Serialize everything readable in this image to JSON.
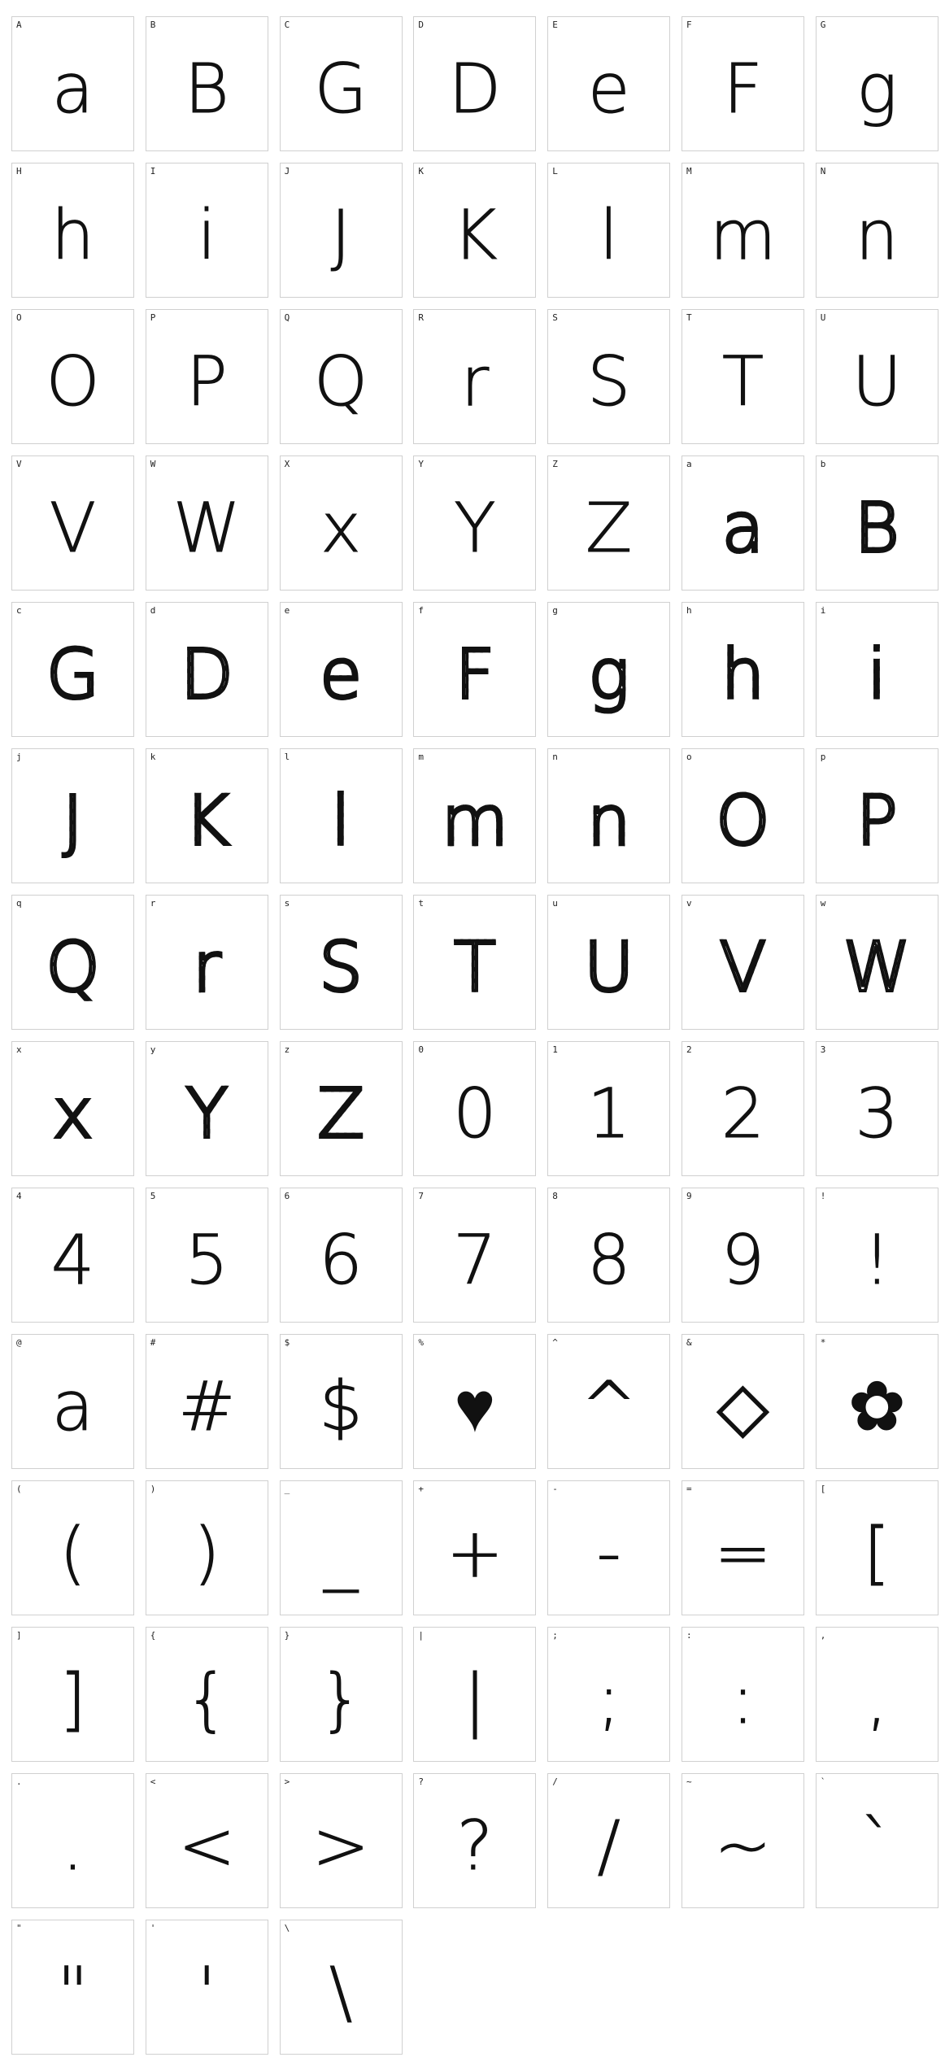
{
  "colors": {
    "background": "#ffffff",
    "cell_border": "#d0d0d0",
    "ink": "#111111"
  },
  "glyphs": [
    {
      "key": "A",
      "char": "a",
      "style": "outline"
    },
    {
      "key": "B",
      "char": "B",
      "style": "outline"
    },
    {
      "key": "C",
      "char": "G",
      "style": "outline"
    },
    {
      "key": "D",
      "char": "D",
      "style": "outline"
    },
    {
      "key": "E",
      "char": "e",
      "style": "outline"
    },
    {
      "key": "F",
      "char": "F",
      "style": "outline"
    },
    {
      "key": "G",
      "char": "g",
      "style": "outline"
    },
    {
      "key": "H",
      "char": "h",
      "style": "outline"
    },
    {
      "key": "I",
      "char": "i",
      "style": "outline"
    },
    {
      "key": "J",
      "char": "J",
      "style": "outline"
    },
    {
      "key": "K",
      "char": "K",
      "style": "outline"
    },
    {
      "key": "L",
      "char": "l",
      "style": "outline"
    },
    {
      "key": "M",
      "char": "m",
      "style": "outline"
    },
    {
      "key": "N",
      "char": "n",
      "style": "outline"
    },
    {
      "key": "O",
      "char": "O",
      "style": "outline"
    },
    {
      "key": "P",
      "char": "P",
      "style": "outline"
    },
    {
      "key": "Q",
      "char": "Q",
      "style": "outline"
    },
    {
      "key": "R",
      "char": "r",
      "style": "outline"
    },
    {
      "key": "S",
      "char": "S",
      "style": "outline"
    },
    {
      "key": "T",
      "char": "T",
      "style": "outline"
    },
    {
      "key": "U",
      "char": "U",
      "style": "outline"
    },
    {
      "key": "V",
      "char": "V",
      "style": "outline"
    },
    {
      "key": "W",
      "char": "W",
      "style": "outline"
    },
    {
      "key": "X",
      "char": "x",
      "style": "outline"
    },
    {
      "key": "Y",
      "char": "Y",
      "style": "outline"
    },
    {
      "key": "Z",
      "char": "Z",
      "style": "outline"
    },
    {
      "key": "a",
      "char": "a",
      "style": "hatched"
    },
    {
      "key": "b",
      "char": "B",
      "style": "hatched"
    },
    {
      "key": "c",
      "char": "G",
      "style": "hatched"
    },
    {
      "key": "d",
      "char": "D",
      "style": "hatched"
    },
    {
      "key": "e",
      "char": "e",
      "style": "hatched"
    },
    {
      "key": "f",
      "char": "F",
      "style": "hatched"
    },
    {
      "key": "g",
      "char": "g",
      "style": "hatched"
    },
    {
      "key": "h",
      "char": "h",
      "style": "hatched"
    },
    {
      "key": "i",
      "char": "i",
      "style": "hatched"
    },
    {
      "key": "j",
      "char": "J",
      "style": "hatched"
    },
    {
      "key": "k",
      "char": "K",
      "style": "hatched"
    },
    {
      "key": "l",
      "char": "l",
      "style": "hatched"
    },
    {
      "key": "m",
      "char": "m",
      "style": "hatched"
    },
    {
      "key": "n",
      "char": "n",
      "style": "hatched"
    },
    {
      "key": "o",
      "char": "O",
      "style": "hatched"
    },
    {
      "key": "p",
      "char": "P",
      "style": "hatched"
    },
    {
      "key": "q",
      "char": "Q",
      "style": "hatched"
    },
    {
      "key": "r",
      "char": "r",
      "style": "hatched"
    },
    {
      "key": "s",
      "char": "S",
      "style": "hatched"
    },
    {
      "key": "t",
      "char": "T",
      "style": "hatched"
    },
    {
      "key": "u",
      "char": "U",
      "style": "hatched"
    },
    {
      "key": "v",
      "char": "V",
      "style": "hatched"
    },
    {
      "key": "w",
      "char": "W",
      "style": "hatched"
    },
    {
      "key": "x",
      "char": "x",
      "style": "hatched"
    },
    {
      "key": "y",
      "char": "Y",
      "style": "hatched"
    },
    {
      "key": "z",
      "char": "Z",
      "style": "hatched"
    },
    {
      "key": "0",
      "char": "0",
      "style": "outline"
    },
    {
      "key": "1",
      "char": "1",
      "style": "outline"
    },
    {
      "key": "2",
      "char": "2",
      "style": "outline"
    },
    {
      "key": "3",
      "char": "3",
      "style": "outline"
    },
    {
      "key": "4",
      "char": "4",
      "style": "outline"
    },
    {
      "key": "5",
      "char": "5",
      "style": "outline"
    },
    {
      "key": "6",
      "char": "6",
      "style": "outline"
    },
    {
      "key": "7",
      "char": "7",
      "style": "outline"
    },
    {
      "key": "8",
      "char": "8",
      "style": "outline"
    },
    {
      "key": "9",
      "char": "9",
      "style": "outline"
    },
    {
      "key": "!",
      "char": "!",
      "style": "outline"
    },
    {
      "key": "@",
      "char": "a",
      "style": "outline"
    },
    {
      "key": "#",
      "char": "#",
      "style": "outline"
    },
    {
      "key": "$",
      "char": "$",
      "style": "outline"
    },
    {
      "key": "%",
      "char": "♥",
      "style": "outline"
    },
    {
      "key": "^",
      "char": "^",
      "style": "outline"
    },
    {
      "key": "&",
      "char": "◇",
      "style": "outline"
    },
    {
      "key": "*",
      "char": "✿",
      "style": "outline"
    },
    {
      "key": "(",
      "char": "(",
      "style": "outline"
    },
    {
      "key": ")",
      "char": ")",
      "style": "outline"
    },
    {
      "key": "_",
      "char": "_",
      "style": "outline"
    },
    {
      "key": "+",
      "char": "+",
      "style": "outline"
    },
    {
      "key": "-",
      "char": "-",
      "style": "outline"
    },
    {
      "key": "=",
      "char": "=",
      "style": "outline"
    },
    {
      "key": "[",
      "char": "[",
      "style": "outline"
    },
    {
      "key": "]",
      "char": "]",
      "style": "outline"
    },
    {
      "key": "{",
      "char": "{",
      "style": "outline"
    },
    {
      "key": "}",
      "char": "}",
      "style": "outline"
    },
    {
      "key": "|",
      "char": "|",
      "style": "outline"
    },
    {
      "key": ";",
      "char": ";",
      "style": "outline"
    },
    {
      "key": ":",
      "char": ":",
      "style": "outline"
    },
    {
      "key": ",",
      "char": ",",
      "style": "outline"
    },
    {
      "key": ".",
      "char": ".",
      "style": "outline"
    },
    {
      "key": "<",
      "char": "<",
      "style": "outline"
    },
    {
      "key": ">",
      "char": ">",
      "style": "outline"
    },
    {
      "key": "?",
      "char": "?",
      "style": "outline"
    },
    {
      "key": "/",
      "char": "/",
      "style": "outline"
    },
    {
      "key": "~",
      "char": "~",
      "style": "outline"
    },
    {
      "key": "`",
      "char": "`",
      "style": "outline"
    },
    {
      "key": "\"",
      "char": "\"",
      "style": "outline"
    },
    {
      "key": "'",
      "char": "'",
      "style": "outline"
    },
    {
      "key": "\\",
      "char": "\\",
      "style": "outline"
    }
  ]
}
